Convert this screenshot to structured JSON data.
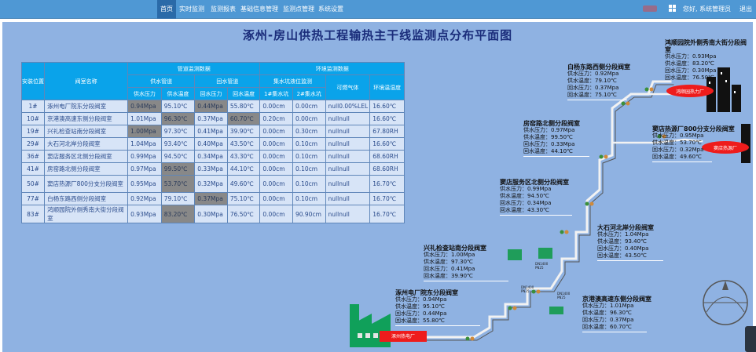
{
  "nav": {
    "items": [
      "首页",
      "实时监测",
      "监测报表",
      "基础信息管理",
      "监测点管理",
      "系统设置"
    ],
    "active": 0,
    "user_label": "您好, 系统管理员",
    "logout": "退出"
  },
  "page_title": "涿州-房山供热工程输热主干线监测点分布平面图",
  "table": {
    "group_headers": {
      "pipe": "管道监测数据",
      "env": "环境监测数据"
    },
    "headers": {
      "pos": "安装位置",
      "name": "阀室名称",
      "supply": "供水管道",
      "return": "回水管道",
      "pit": "集水坑液位监测",
      "gas": "可燃气体",
      "temp": "环境温湿度",
      "s_pressure": "供水压力",
      "s_temp": "供水温度",
      "r_pressure": "回水压力",
      "r_temp": "回水温度",
      "pit1": "1#集水坑",
      "pit2": "2#集水坑"
    },
    "rows": [
      {
        "pos": "1#",
        "name": "涿州电厂院东分段阀室",
        "sp": "0.94Mpa",
        "st": "95.10℃",
        "rp": "0.44Mpa",
        "rt": "55.80℃",
        "p1": "0.00cm",
        "p2": "0.00cm",
        "gas": "null0.00%LEL",
        "temp": "16.60℃"
      },
      {
        "pos": "10#",
        "name": "京港澳高速东侧分段阀室",
        "sp": "1.01Mpa",
        "st": "96.30℃",
        "rp": "0.37Mpa",
        "rt": "60.70℃",
        "p1": "0.20cm",
        "p2": "0.00cm",
        "gas": "nullnull",
        "temp": "16.60℃"
      },
      {
        "pos": "19#",
        "name": "兴礼检查站南分段阀室",
        "sp": "1.00Mpa",
        "st": "97.30℃",
        "rp": "0.41Mpa",
        "rt": "39.90℃",
        "p1": "0.00cm",
        "p2": "0.30cm",
        "gas": "nullnull",
        "temp": "67.80RH"
      },
      {
        "pos": "29#",
        "name": "大石河北岸分段阀室",
        "sp": "1.04Mpa",
        "st": "93.40℃",
        "rp": "0.40Mpa",
        "rt": "43.50℃",
        "p1": "0.00cm",
        "p2": "0.10cm",
        "gas": "nullnull",
        "temp": "16.60℃"
      },
      {
        "pos": "36#",
        "name": "窦店服务区北侧分段阀室",
        "sp": "0.99Mpa",
        "st": "94.50℃",
        "rp": "0.34Mpa",
        "rt": "43.30℃",
        "p1": "0.00cm",
        "p2": "0.10cm",
        "gas": "nullnull",
        "temp": "68.60RH"
      },
      {
        "pos": "41#",
        "name": "房窑路北侧分段阀室",
        "sp": "0.97Mpa",
        "st": "99.50℃",
        "rp": "0.33Mpa",
        "rt": "44.10℃",
        "p1": "0.00cm",
        "p2": "0.10cm",
        "gas": "nullnull",
        "temp": "68.60RH"
      },
      {
        "pos": "50#",
        "name": "窦店热源厂800分支分段阀室",
        "sp": "0.95Mpa",
        "st": "53.70℃",
        "rp": "0.32Mpa",
        "rt": "49.60℃",
        "p1": "0.00cm",
        "p2": "0.10cm",
        "gas": "nullnull",
        "temp": "16.70℃"
      },
      {
        "pos": "77#",
        "name": "白杨东路西侧分段阀室",
        "sp": "0.92Mpa",
        "st": "79.10℃",
        "rp": "0.37Mpa",
        "rt": "75.10℃",
        "p1": "0.00cm",
        "p2": "0.10cm",
        "gas": "nullnull",
        "temp": "16.70℃"
      },
      {
        "pos": "83#",
        "name": "鸿顺园院外侧秀南大街分段阀室",
        "sp": "0.93Mpa",
        "st": "83.20℃",
        "rp": "0.30Mpa",
        "rt": "76.50℃",
        "p1": "0.00cm",
        "p2": "90.90cm",
        "gas": "nullnull",
        "temp": "16.70℃"
      }
    ]
  },
  "stations": [
    {
      "name": "涿州电厂院东分段阀室",
      "sp": "0.94Mpa",
      "st": "95.10℃",
      "rp": "0.44Mpa",
      "rt": "55.80℃"
    },
    {
      "name": "兴礼检查站南分段阀室",
      "sp": "1.00Mpa",
      "st": "97.30℃",
      "rp": "0.41Mpa",
      "rt": "39.90℃"
    },
    {
      "name": "窦店服务区北侧分段阀室",
      "sp": "0.99Mpa",
      "st": "94.50℃",
      "rp": "0.34Mpa",
      "rt": "43.30℃"
    },
    {
      "name": "房窑路北侧分段阀室",
      "sp": "0.97Mpa",
      "st": "99.50℃",
      "rp": "0.33Mpa",
      "rt": "44.10℃"
    },
    {
      "name": "白杨东路西侧分段阀室",
      "sp": "0.92Mpa",
      "st": "79.10℃",
      "rp": "0.37Mpa",
      "rt": "75.10℃"
    },
    {
      "name": "鸿顺园院外侧秀南大街分段阀室",
      "sp": "0.93Mpa",
      "st": "83.20℃",
      "rp": "0.30Mpa",
      "rt": "76.50℃"
    },
    {
      "name": "窦店热源厂800分支分段阀室",
      "sp": "0.95Mpa",
      "st": "53.70℃",
      "rp": "0.32Mpa",
      "rt": "49.60℃"
    },
    {
      "name": "大石河北岸分段阀室",
      "sp": "1.04Mpa",
      "st": "93.40℃",
      "rp": "0.40Mpa",
      "rt": "43.50℃"
    },
    {
      "name": "京港澳高速东侧分段阀室",
      "sp": "1.01Mpa",
      "st": "96.30℃",
      "rp": "0.37Mpa",
      "rt": "60.70℃"
    }
  ],
  "labels": {
    "supply_pressure": "供水压力：",
    "supply_temp": "供水温度：",
    "return_pressure": "回水压力：",
    "return_temp": "回水温度："
  },
  "map_labels": {
    "plant": "涿州热电厂",
    "hongshun": "鸿顺园热力厂",
    "doudian": "窦店热源厂"
  },
  "colors": {
    "nav_bg": "#4f98d4",
    "canvas_bg": "#8fb2e2",
    "table_header": "#0aa3ea",
    "table_cell": "#d7e4f7",
    "alarm_cell": "#888888",
    "plant_red": "#ee1c1c",
    "factory_green": "#10a05a"
  }
}
